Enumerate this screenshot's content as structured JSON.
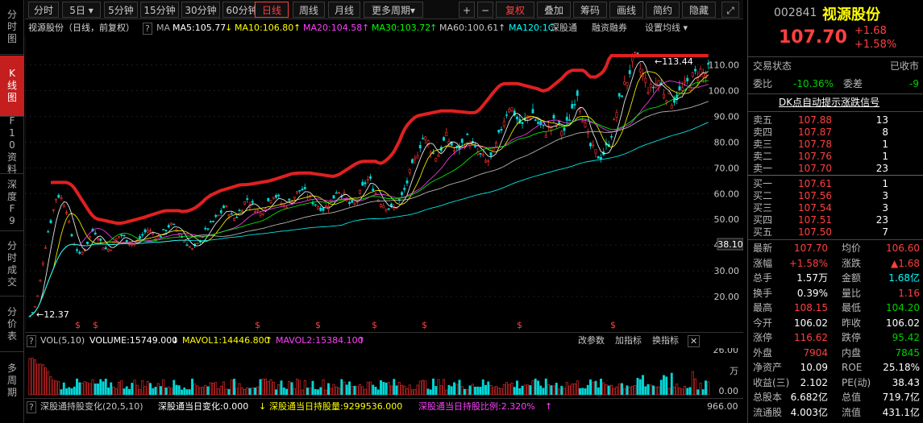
{
  "left_nav": [
    {
      "label": "分时图",
      "active": false
    },
    {
      "label": "K线图",
      "active": true
    },
    {
      "label": "F10资料",
      "active": false
    },
    {
      "label": "深度F9",
      "active": false
    },
    {
      "label": "分时成交",
      "active": false
    },
    {
      "label": "分价表",
      "active": false
    },
    {
      "label": "多周期",
      "active": false
    }
  ],
  "toolbar": {
    "periods": [
      "分时",
      "5日",
      "5分钟",
      "15分钟",
      "30分钟",
      "60分钟",
      "日线",
      "周线",
      "月线",
      "更多周期"
    ],
    "active_period": "日线",
    "five_day_dropdown": "▾",
    "more_dropdown": "▾",
    "right_buttons": [
      "复权",
      "叠加",
      "筹码",
      "画线",
      "简约",
      "隐藏"
    ],
    "plus": "+",
    "minus": "−",
    "expand_icon": "⤢"
  },
  "ma_line": {
    "stock_label": "视源股份（日线，前复权）",
    "help": "?",
    "ma_prefix": "MA",
    "ma5": "MA5:105.77",
    "ma10": "MA10:106.80",
    "ma20": "MA20:104.58",
    "ma30": "MA30:103.72",
    "ma60": "MA60:100.61",
    "ma120": "MA120:1C",
    "arrow_up": "↑",
    "arrow_down": "↓",
    "link_hk": "深股通",
    "link_margin": "融资融券",
    "settings": "设置均线 ▾",
    "colors": {
      "ma5": "#ffffff",
      "ma10": "#ffff00",
      "ma20": "#ff40ff",
      "ma30": "#00ff00",
      "ma60": "#c8c8c8",
      "ma120": "#00ffff"
    }
  },
  "chart_data": {
    "type": "candlestick",
    "y_axis_labels": [
      "110.00",
      "100.00",
      "90.00",
      "80.00",
      "70.00",
      "60.00",
      "50.00",
      "40.00",
      "30.00",
      "20.00"
    ],
    "current_price_tag": "38.10",
    "high_annotation": "113.44",
    "low_annotation": "12.37",
    "dividend_markers": [
      "$",
      "$",
      "$",
      "$",
      "$",
      "$",
      "$",
      "$"
    ],
    "ylim": [
      10,
      118
    ],
    "trend": [
      12.4,
      15,
      22,
      35,
      45,
      52,
      60,
      58,
      55,
      45,
      40,
      36,
      38,
      42,
      46,
      44,
      40,
      38,
      39,
      42,
      44,
      43,
      41,
      40,
      42,
      44,
      46,
      45,
      43,
      44,
      46,
      48,
      47,
      45,
      42,
      40,
      38,
      40,
      43,
      46,
      48,
      50,
      52,
      55,
      53,
      50,
      52,
      55,
      58,
      56,
      54,
      52,
      55,
      58,
      60,
      58,
      55,
      56,
      58,
      60,
      62,
      60,
      58,
      56,
      55,
      54,
      56,
      58,
      62,
      60,
      58,
      55,
      56,
      60,
      64,
      66,
      62,
      58,
      56,
      55,
      54,
      55,
      58,
      62,
      68,
      72,
      78,
      82,
      80,
      76,
      74,
      78,
      82,
      80,
      76,
      78,
      80,
      82,
      78,
      76,
      74,
      72,
      74,
      78,
      84,
      90,
      94,
      92,
      88,
      86,
      90,
      92,
      88,
      86,
      84,
      86,
      88,
      86,
      84,
      88,
      94,
      100,
      92,
      84,
      78,
      76,
      74,
      76,
      80,
      86,
      94,
      100,
      104,
      110,
      113,
      108,
      104,
      100,
      102,
      104,
      100,
      98,
      96,
      98,
      100,
      102,
      104,
      106,
      108,
      106,
      107.7
    ]
  },
  "volume": {
    "label": "VOL(5,10)",
    "volume": "VOLUME:15749.000",
    "vol_arrow": "↓",
    "mavol1": "MAVOL1:14446.800",
    "mavol1_arrow": "↑",
    "mavol2": "MAVOL2:15384.100",
    "mavol2_arrow": "↑",
    "axis_top": "26.00",
    "axis_unit": "万",
    "axis_bottom": "0.00",
    "btn_params": "改参数",
    "btn_add": "加指标",
    "btn_switch": "换指标",
    "close": "✕"
  },
  "hk_panel": {
    "label": "深股通持股变化(20,5,10)",
    "change": "深股通当日变化:0.000",
    "change_arrow": "↓",
    "hold": "深股通当日持股量:9299536.000",
    "ratio": "深股通当日持股比例:2.320%",
    "ratio_arrow": "↑",
    "axis_value": "966.00"
  },
  "quote": {
    "code": "002841",
    "name": "视源股份",
    "price": "107.70",
    "change": "+1.68",
    "change_pct": "+1.58%",
    "status_label": "交易状态",
    "status_value": "已收市",
    "wb_label": "委比",
    "wb_value": "-10.36%",
    "wc_label": "委差",
    "wc_value": "-9",
    "signal": "DK点自动提示涨跌信号",
    "asks": [
      {
        "label": "卖五",
        "price": "107.88",
        "vol": "13"
      },
      {
        "label": "卖四",
        "price": "107.87",
        "vol": "8"
      },
      {
        "label": "卖三",
        "price": "107.78",
        "vol": "1"
      },
      {
        "label": "卖二",
        "price": "107.76",
        "vol": "1"
      },
      {
        "label": "卖一",
        "price": "107.70",
        "vol": "23"
      }
    ],
    "bids": [
      {
        "label": "买一",
        "price": "107.61",
        "vol": "1"
      },
      {
        "label": "买二",
        "price": "107.56",
        "vol": "3"
      },
      {
        "label": "买三",
        "price": "107.54",
        "vol": "3"
      },
      {
        "label": "买四",
        "price": "107.51",
        "vol": "23"
      },
      {
        "label": "买五",
        "price": "107.50",
        "vol": "7"
      }
    ],
    "stats": [
      {
        "l1": "最新",
        "v1": "107.70",
        "c1": "red",
        "l2": "均价",
        "v2": "106.60",
        "c2": "red"
      },
      {
        "l1": "涨幅",
        "v1": "+1.58%",
        "c1": "red",
        "l2": "涨跌",
        "v2": "▲1.68",
        "c2": "red"
      },
      {
        "l1": "总手",
        "v1": "1.57万",
        "c1": "white",
        "l2": "金额",
        "v2": "1.68亿",
        "c2": "cyan"
      },
      {
        "l1": "换手",
        "v1": "0.39%",
        "c1": "white",
        "l2": "量比",
        "v2": "1.16",
        "c2": "red"
      },
      {
        "l1": "最高",
        "v1": "108.15",
        "c1": "red",
        "l2": "最低",
        "v2": "104.20",
        "c2": "green"
      },
      {
        "l1": "今开",
        "v1": "106.02",
        "c1": "white",
        "l2": "昨收",
        "v2": "106.02",
        "c2": "white"
      },
      {
        "l1": "涨停",
        "v1": "116.62",
        "c1": "red",
        "l2": "跌停",
        "v2": "95.42",
        "c2": "green"
      },
      {
        "l1": "外盘",
        "v1": "7904",
        "c1": "red",
        "l2": "内盘",
        "v2": "7845",
        "c2": "green"
      },
      {
        "l1": "净资产",
        "v1": "10.09",
        "c1": "white",
        "l2": "ROE",
        "v2": "25.18%",
        "c2": "white"
      },
      {
        "l1": "收益(三)",
        "v1": "2.102",
        "c1": "white",
        "l2": "PE(动)",
        "v2": "38.43",
        "c2": "white"
      },
      {
        "l1": "总股本",
        "v1": "6.682亿",
        "c1": "white",
        "l2": "总值",
        "v2": "719.7亿",
        "c2": "white"
      },
      {
        "l1": "流通股",
        "v1": "4.003亿",
        "c1": "white",
        "l2": "流值",
        "v2": "431.1亿",
        "c2": "white"
      }
    ]
  }
}
